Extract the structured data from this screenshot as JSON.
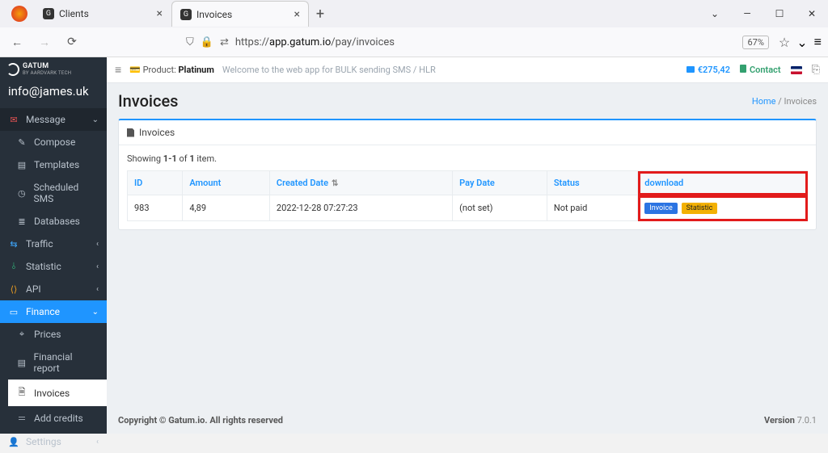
{
  "browser": {
    "tabs": [
      {
        "title": "Clients"
      },
      {
        "title": "Invoices"
      }
    ],
    "url_prefix": "https://",
    "url_host": "app.gatum.io",
    "url_path": "/pay/invoices",
    "zoom": "67%"
  },
  "logo_text": "GATUM",
  "logo_sub": "BY AARDVARK TECH",
  "account_email": "info@james.uk",
  "sidebar": {
    "message": "Message",
    "compose": "Compose",
    "templates": "Templates",
    "scheduled": "Scheduled SMS",
    "databases": "Databases",
    "traffic": "Traffic",
    "statistic": "Statistic",
    "api": "API",
    "finance": "Finance",
    "prices": "Prices",
    "finreport": "Financial report",
    "invoices": "Invoices",
    "addcredits": "Add credits",
    "settings": "Settings"
  },
  "topbar": {
    "product_label": "Product:",
    "product_name": "Platinum",
    "welcome": "Welcome to the web app for BULK sending SMS / HLR",
    "balance": "€275,42",
    "contact": "Contact"
  },
  "page": {
    "title": "Invoices",
    "crumb_home": "Home",
    "crumb_sep": "/",
    "crumb_here": "Invoices"
  },
  "panel": {
    "title": "Invoices",
    "summary_a": "Showing ",
    "summary_b": "1-1",
    "summary_c": " of ",
    "summary_d": "1",
    "summary_e": " item.",
    "cols": {
      "id": "ID",
      "amount": "Amount",
      "created": "Created Date",
      "paydate": "Pay Date",
      "status": "Status",
      "download": "download"
    },
    "row": {
      "id": "983",
      "amount": "4,89",
      "created": "2022-12-28 07:27:23",
      "paydate": "(not set)",
      "status": "Not paid",
      "btn_invoice": "Invoice",
      "btn_statistic": "Statistic"
    }
  },
  "footer": {
    "copyright_a": "Copyright © Gatum.io. All rights reserved",
    "version_label": "Version ",
    "version": "7.0.1"
  }
}
